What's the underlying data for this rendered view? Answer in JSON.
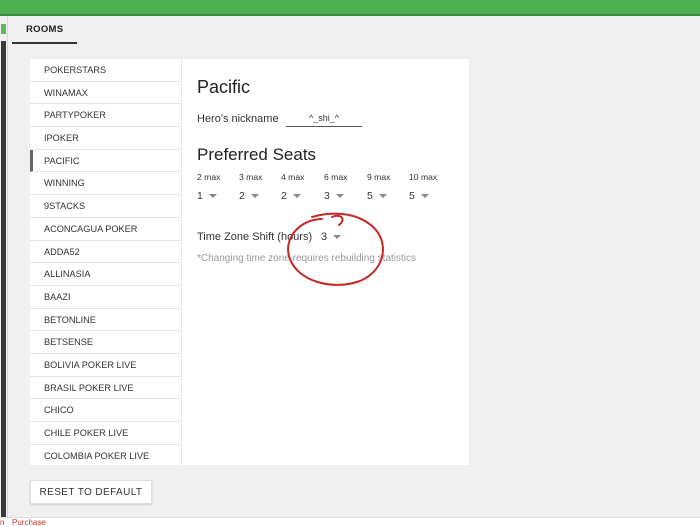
{
  "tabs": {
    "rooms": "ROOMS"
  },
  "rooms": [
    "POKERSTARS",
    "WINAMAX",
    "PARTYPOKER",
    "IPOKER",
    "PACIFIC",
    "WINNING",
    "9STACKS",
    "ACONCAGUA POKER",
    "ADDA52",
    "ALLINASIA",
    "BAAZI",
    "BETONLINE",
    "BETSENSE",
    "BOLIVIA POKER LIVE",
    "BRASIL POKER LIVE",
    "CHICO",
    "CHILE POKER LIVE",
    "COLOMBIA POKER LIVE"
  ],
  "active_room": "PACIFIC",
  "detail": {
    "title": "Pacific",
    "nickname_label": "Hero's nickname",
    "nickname_value": "^_shi_^",
    "seats_title": "Preferred Seats",
    "seats": [
      {
        "label": "2 max",
        "value": "1"
      },
      {
        "label": "3 max",
        "value": "2"
      },
      {
        "label": "4 max",
        "value": "2"
      },
      {
        "label": "6 max",
        "value": "3"
      },
      {
        "label": "9 max",
        "value": "5"
      },
      {
        "label": "10 max",
        "value": "5"
      }
    ],
    "tz_label": "Time Zone Shift (hours)",
    "tz_value": "3",
    "tz_note": "*Changing time zone requires rebuilding statistics"
  },
  "actions": {
    "reset": "RESET TO DEFAULT"
  },
  "footer": {
    "purchase": "Purchase",
    "left_char": "n"
  },
  "colors": {
    "accent": "#4caf50",
    "annotation": "#c62828"
  }
}
